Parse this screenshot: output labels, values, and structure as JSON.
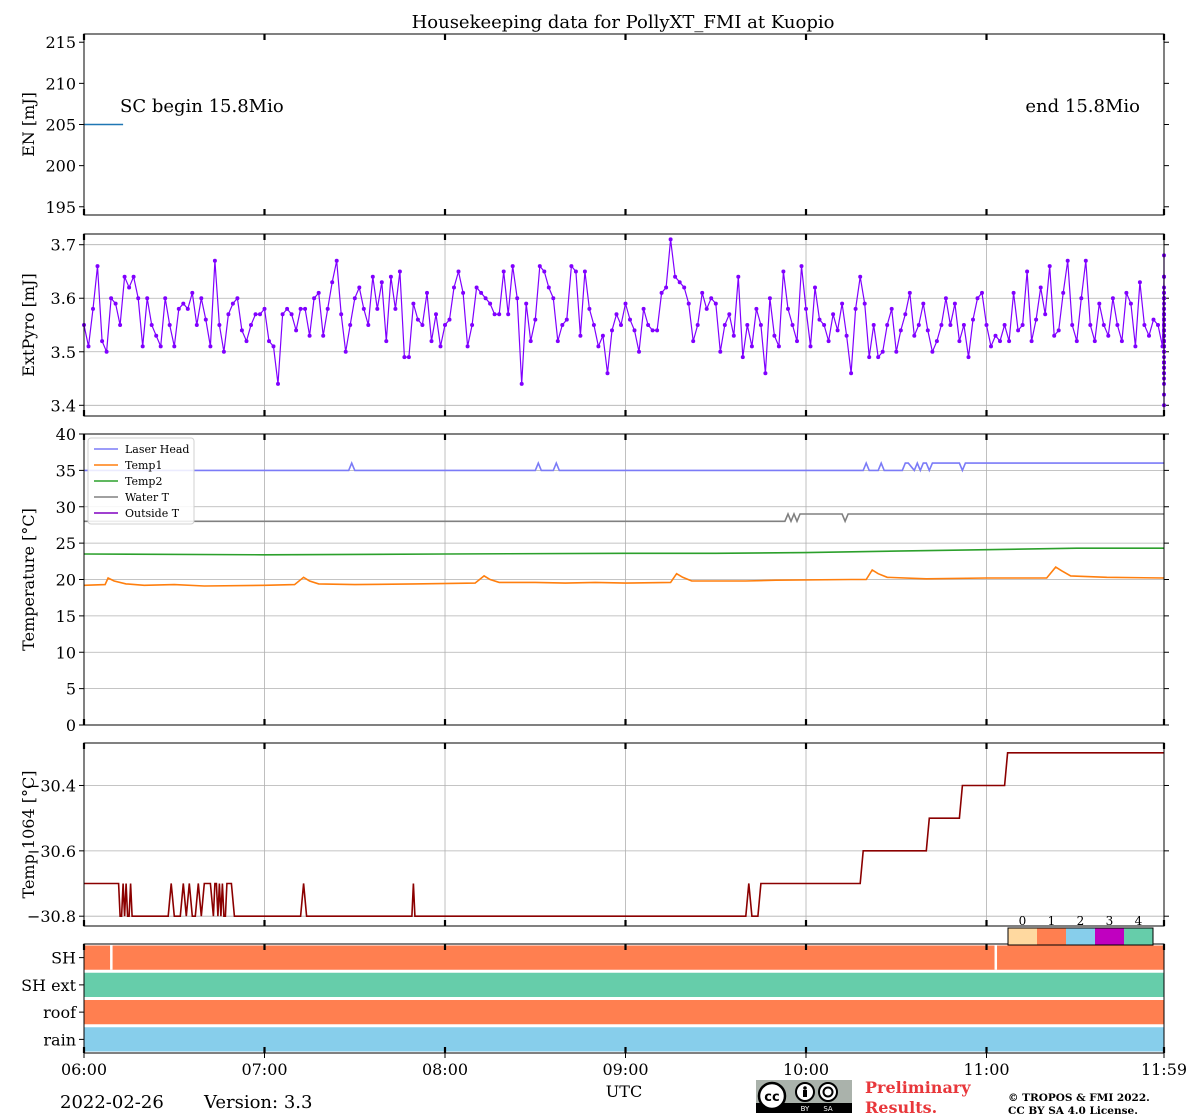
{
  "title": "Housekeeping data for PollyXT_FMI at Kuopio",
  "footer": {
    "date": "2022-02-26",
    "version": "Version: 3.3",
    "preliminary_line1": "Preliminary",
    "preliminary_line2": "Results.",
    "copyright_line1": "© TROPOS & FMI 2022.",
    "copyright_line2": "CC BY SA 4.0 License.",
    "license_badge_text": "cc BY SA"
  },
  "x_axis": {
    "label": "UTC",
    "ticks": [
      "06:00",
      "07:00",
      "08:00",
      "09:00",
      "10:00",
      "11:00",
      "11:59"
    ],
    "range_minutes": [
      0,
      359
    ]
  },
  "chart_data": [
    {
      "type": "line",
      "panel": "energy",
      "ylabel": "EN [mJ]",
      "ylim": [
        194,
        216
      ],
      "yticks": [
        195,
        200,
        205,
        210,
        215
      ],
      "grid": false,
      "annotations": [
        "SC begin 15.8Mio",
        "end 15.8Mio"
      ],
      "series": [
        {
          "color": "#1f77b4",
          "x_minutes": [
            0,
            13,
            14,
            195,
            196,
            359
          ],
          "y": [
            205,
            205,
            null,
            205,
            null,
            205
          ]
        }
      ]
    },
    {
      "type": "line",
      "panel": "extpyro",
      "ylabel": "ExtPyro [mJ]",
      "ylim": [
        3.38,
        3.72
      ],
      "yticks": [
        3.4,
        3.5,
        3.6,
        3.7
      ],
      "grid": true,
      "series": [
        {
          "color": "#8000ff",
          "marker": "dot",
          "x_minutes_start": 0,
          "x_minutes_step": 1.5,
          "y": [
            3.55,
            3.51,
            3.58,
            3.66,
            3.52,
            3.5,
            3.6,
            3.59,
            3.55,
            3.64,
            3.62,
            3.64,
            3.6,
            3.51,
            3.6,
            3.55,
            3.53,
            3.51,
            3.6,
            3.55,
            3.51,
            3.58,
            3.59,
            3.58,
            3.61,
            3.55,
            3.6,
            3.56,
            3.51,
            3.67,
            3.55,
            3.5,
            3.57,
            3.59,
            3.6,
            3.54,
            3.52,
            3.55,
            3.57,
            3.57,
            3.58,
            3.52,
            3.51,
            3.44,
            3.57,
            3.58,
            3.57,
            3.54,
            3.58,
            3.58,
            3.53,
            3.6,
            3.61,
            3.53,
            3.58,
            3.63,
            3.67,
            3.57,
            3.5,
            3.55,
            3.6,
            3.62,
            3.58,
            3.55,
            3.64,
            3.58,
            3.63,
            3.52,
            3.64,
            3.58,
            3.65,
            3.49,
            3.49,
            3.59,
            3.56,
            3.55,
            3.61,
            3.52,
            3.57,
            3.51,
            3.55,
            3.56,
            3.62,
            3.65,
            3.61,
            3.51,
            3.55,
            3.62,
            3.61,
            3.6,
            3.59,
            3.57,
            3.57,
            3.65,
            3.57,
            3.66,
            3.6,
            3.44,
            3.59,
            3.52,
            3.56,
            3.66,
            3.65,
            3.62,
            3.6,
            3.52,
            3.55,
            3.56,
            3.66,
            3.65,
            3.53,
            3.65,
            3.58,
            3.55,
            3.51,
            3.53,
            3.46,
            3.54,
            3.57,
            3.55,
            3.59,
            3.56,
            3.54,
            3.5,
            3.58,
            3.55,
            3.54,
            3.54,
            3.61,
            3.62,
            3.71,
            3.64,
            3.63,
            3.62,
            3.59,
            3.52,
            3.55,
            3.61,
            3.58,
            3.6,
            3.59,
            3.5,
            3.55,
            3.57,
            3.53,
            3.64,
            3.49,
            3.55,
            3.51,
            3.58,
            3.55,
            3.46,
            3.6,
            3.53,
            3.51,
            3.65,
            3.58,
            3.55,
            3.52,
            3.66,
            3.58,
            3.51,
            3.62,
            3.56,
            3.55,
            3.52,
            3.57,
            3.54,
            3.59,
            3.53,
            3.46,
            3.58,
            3.64,
            3.59,
            3.49,
            3.55,
            3.49,
            3.5,
            3.55,
            3.58,
            3.5,
            3.54,
            3.57,
            3.61,
            3.53,
            3.55,
            3.59,
            3.54,
            3.5,
            3.52,
            3.55,
            3.6,
            3.55,
            3.59,
            3.52,
            3.55,
            3.49,
            3.56,
            3.6,
            3.61,
            3.55,
            3.51,
            3.53,
            3.52,
            3.55,
            3.52,
            3.61,
            3.54,
            3.55,
            3.65,
            3.52,
            3.56,
            3.62,
            3.57,
            3.66,
            3.53,
            3.54,
            3.61,
            3.67,
            3.55,
            3.52,
            3.6,
            3.67,
            3.55,
            3.52,
            3.59,
            3.55,
            3.53,
            3.6,
            3.55,
            3.52,
            3.61,
            3.59,
            3.51,
            3.63,
            3.55,
            3.53,
            3.56,
            3.55,
            3.51,
            3.64,
            3.57,
            3.53,
            3.62,
            3.52,
            3.64,
            3.48,
            3.51,
            3.56,
            3.61,
            3.6,
            3.5,
            3.56,
            3.58,
            3.48,
            3.57,
            3.61,
            3.55,
            3.58,
            3.52,
            3.55,
            3.57,
            3.6,
            3.51,
            3.55,
            3.54,
            3.52,
            3.56,
            3.55,
            3.53,
            3.6,
            3.57,
            3.53,
            3.51,
            3.56,
            3.6,
            3.58,
            3.53,
            3.6,
            3.52,
            3.68,
            3.54,
            3.55,
            3.57,
            3.55,
            3.56,
            3.54,
            3.55,
            3.48,
            3.56,
            3.6,
            3.55,
            3.52,
            3.51,
            3.55,
            3.55,
            3.52,
            3.48,
            3.54,
            3.52,
            3.6,
            3.48,
            3.53,
            3.57,
            3.56,
            3.55,
            3.51,
            3.51,
            3.6,
            3.51,
            3.53,
            3.56,
            3.52,
            3.55,
            3.5,
            3.54,
            3.55,
            3.51,
            3.57,
            3.48,
            3.47,
            3.55,
            3.54,
            3.5,
            3.46,
            3.42,
            3.59,
            3.56,
            3.51,
            3.5,
            3.45,
            3.54,
            3.52,
            3.48,
            3.52,
            3.47,
            3.46,
            3.64,
            3.44,
            3.47,
            3.48,
            3.52,
            3.53,
            3.49,
            3.57,
            3.4
          ]
        }
      ]
    },
    {
      "type": "line",
      "panel": "temperature",
      "ylabel": "Temperature [$^\\circ C$]",
      "ylim": [
        0,
        40
      ],
      "yticks": [
        0,
        5,
        10,
        15,
        20,
        25,
        30,
        35,
        40
      ],
      "grid": true,
      "legend_position": "upper-left",
      "series": [
        {
          "name": "Laser Head",
          "color": "#7b7bf7",
          "x_minutes": [
            0,
            88,
            89,
            90,
            150,
            151,
            152,
            156,
            157,
            158,
            259,
            260,
            261,
            264,
            265,
            266,
            272,
            273,
            274,
            276,
            277,
            278,
            279,
            280,
            281,
            282,
            283,
            291,
            292,
            293,
            359
          ],
          "y": [
            35,
            35,
            36,
            35,
            35,
            36,
            35,
            35,
            36,
            35,
            35,
            36,
            35,
            35,
            36,
            35,
            35,
            36,
            36,
            35,
            36,
            35,
            36,
            36,
            35,
            36,
            36,
            36,
            35,
            36,
            36
          ]
        },
        {
          "name": "Temp1",
          "color": "#ff7f0e",
          "x_minutes": [
            0,
            7,
            8,
            10,
            14,
            20,
            30,
            40,
            60,
            70,
            73,
            75,
            78,
            90,
            110,
            130,
            133,
            135,
            138,
            150,
            160,
            170,
            180,
            195,
            197,
            199,
            202,
            220,
            230,
            255,
            260,
            262,
            264,
            267,
            280,
            300,
            320,
            323,
            325,
            328,
            340,
            359
          ],
          "y": [
            19.2,
            19.3,
            20.2,
            19.8,
            19.4,
            19.2,
            19.3,
            19.1,
            19.2,
            19.3,
            20.3,
            19.8,
            19.4,
            19.3,
            19.4,
            19.5,
            20.5,
            20.0,
            19.6,
            19.6,
            19.5,
            19.6,
            19.5,
            19.6,
            20.8,
            20.3,
            19.8,
            19.8,
            19.9,
            20.0,
            20.0,
            21.3,
            20.8,
            20.3,
            20.1,
            20.2,
            20.2,
            21.7,
            21.2,
            20.5,
            20.3,
            20.2
          ]
        },
        {
          "name": "Temp2",
          "color": "#2ca02c",
          "x_minutes": [
            0,
            60,
            120,
            180,
            210,
            240,
            270,
            300,
            330,
            359
          ],
          "y": [
            23.5,
            23.4,
            23.5,
            23.6,
            23.6,
            23.7,
            23.9,
            24.1,
            24.3,
            24.3
          ]
        },
        {
          "name": "Water T",
          "color": "#808080",
          "x_minutes": [
            0,
            81,
            82,
            233,
            234,
            235,
            236,
            237,
            238,
            240,
            252,
            253,
            254,
            359
          ],
          "y": [
            28,
            28,
            28,
            28,
            29,
            28,
            29,
            28,
            29,
            29,
            29,
            28,
            29,
            29
          ]
        },
        {
          "name": "Outside T",
          "color": "#8000c0",
          "x_minutes": [],
          "y": []
        }
      ]
    },
    {
      "type": "line",
      "panel": "temp1064",
      "ylabel": "Temp 1064 [$^\\circ C$]",
      "ylim": [
        -30.83,
        -30.27
      ],
      "yticks": [
        -30.8,
        -30.6,
        -30.4
      ],
      "grid": true,
      "series": [
        {
          "color": "#8b0000",
          "x_minutes": [
            0,
            11.5,
            12,
            12.5,
            13,
            13.5,
            14,
            14.5,
            15,
            15.5,
            16,
            16.5,
            17,
            28,
            29,
            30,
            32,
            33,
            34,
            35,
            36,
            37,
            38,
            39,
            40,
            41,
            42,
            43,
            43.5,
            44,
            44.5,
            45,
            45.5,
            46,
            46.5,
            47,
            47.5,
            48,
            49,
            50,
            50.5,
            51,
            72,
            73,
            74,
            109,
            109.5,
            110,
            110.5,
            111,
            220,
            221,
            222,
            224,
            225,
            258,
            259,
            280,
            281,
            291,
            292,
            306,
            307,
            325,
            326,
            359
          ],
          "y": [
            -30.7,
            -30.7,
            -30.8,
            -30.8,
            -30.7,
            -30.8,
            -30.7,
            -30.8,
            -30.8,
            -30.7,
            -30.8,
            -30.8,
            -30.8,
            -30.8,
            -30.7,
            -30.8,
            -30.8,
            -30.7,
            -30.8,
            -30.7,
            -30.8,
            -30.8,
            -30.7,
            -30.8,
            -30.7,
            -30.7,
            -30.7,
            -30.8,
            -30.7,
            -30.7,
            -30.8,
            -30.7,
            -30.8,
            -30.7,
            -30.8,
            -30.8,
            -30.7,
            -30.7,
            -30.7,
            -30.8,
            -30.8,
            -30.8,
            -30.8,
            -30.7,
            -30.8,
            -30.8,
            -30.7,
            -30.8,
            -30.8,
            -30.8,
            -30.8,
            -30.7,
            -30.8,
            -30.8,
            -30.7,
            -30.7,
            -30.6,
            -30.6,
            -30.5,
            -30.5,
            -30.4,
            -30.4,
            -30.3,
            -30.3,
            -30.3,
            -30.3
          ]
        }
      ]
    },
    {
      "type": "heatmap",
      "panel": "status",
      "rows": [
        "SH",
        "SH ext",
        "roof",
        "rain"
      ],
      "colorbar": {
        "ticks": [
          "0",
          "1",
          "2",
          "3",
          "4"
        ],
        "colors": [
          "#ffd9a0",
          "#ff7f50",
          "#87ceeb",
          "#c000c0",
          "#66cdaa"
        ]
      },
      "segments": [
        {
          "row": "SH",
          "x_minutes": [
            0,
            359
          ],
          "state": 1,
          "gaps_minutes": [
            9,
            303
          ]
        },
        {
          "row": "SH ext",
          "x_minutes": [
            0,
            359
          ],
          "state": 4
        },
        {
          "row": "roof",
          "x_minutes": [
            0,
            359
          ],
          "state": 1
        },
        {
          "row": "rain",
          "x_minutes": [
            0,
            359
          ],
          "state": 2
        }
      ]
    }
  ]
}
